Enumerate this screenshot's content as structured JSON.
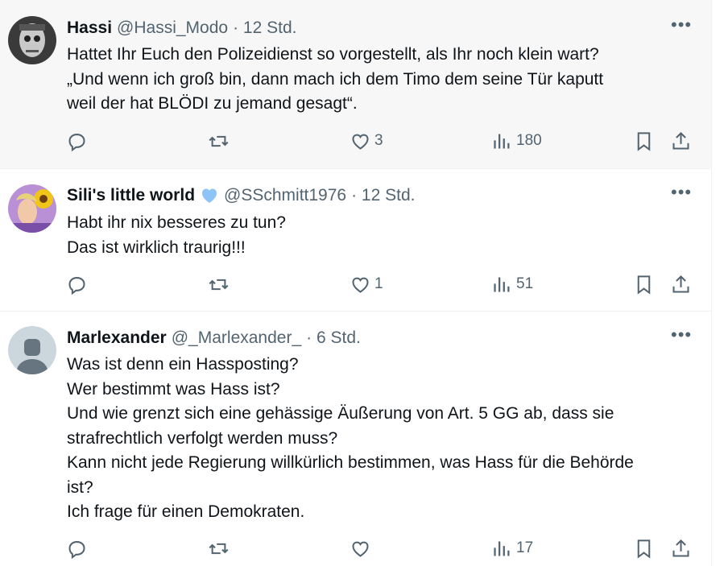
{
  "tweets": [
    {
      "name": "Hassi",
      "handle": "@Hassi_Modo",
      "time": "· 12 Std.",
      "lines": [
        "Hattet Ihr Euch den Polizeidienst so vorgestellt, als Ihr noch klein wart?",
        "„Und wenn ich groß bin, dann mach ich dem Timo dem seine Tür kaputt",
        "weil der hat BLÖDI zu jemand gesagt“."
      ],
      "replies": "",
      "retweets": "",
      "likes": "3",
      "views": "180",
      "verified": false
    },
    {
      "name": "Sili's little world",
      "handle": "@SSchmitt1976",
      "time": "· 12 Std.",
      "lines": [
        "Habt ihr nix besseres zu tun?",
        "Das ist wirklich traurig!!!"
      ],
      "replies": "",
      "retweets": "",
      "likes": "1",
      "views": "51",
      "verified": true
    },
    {
      "name": "Marlexander",
      "handle": "@_Marlexander_",
      "time": "· 6 Std.",
      "lines": [
        "Was ist denn ein Hassposting?",
        "Wer bestimmt was Hass ist?",
        "Und wie grenzt sich eine gehässige Äußerung von Art. 5 GG ab, dass sie",
        "strafrechtlich verfolgt werden muss?",
        "Kann nicht jede Regierung willkürlich bestimmen, was Hass für die Behörde",
        "ist?",
        "Ich frage für einen Demokraten."
      ],
      "replies": "",
      "retweets": "",
      "likes": "",
      "views": "17",
      "verified": false
    }
  ],
  "icons": {
    "reply": "reply-icon",
    "retweet": "retweet-icon",
    "like": "heart-icon",
    "views": "views-icon",
    "bookmark": "bookmark-icon",
    "share": "share-icon",
    "more": "more-icon"
  },
  "colors": {
    "text": "#0f1419",
    "secondary": "#536471",
    "hover_bg": "#f7f7f7",
    "verified": "#8ec3f7"
  }
}
